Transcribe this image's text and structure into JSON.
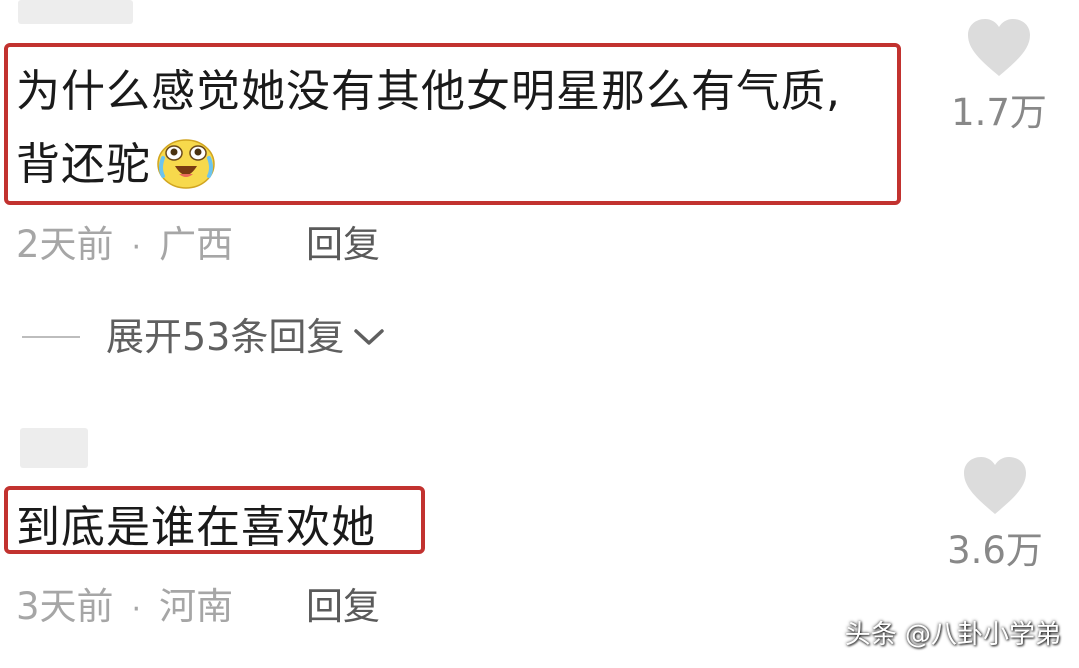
{
  "comments": [
    {
      "text_line1": "为什么感觉她没有其他女明星那么有气质,",
      "text_line2": "背还驼",
      "emoji": "laughing-crying-emoji",
      "time": "2天前",
      "separator": "·",
      "location": "广西",
      "reply_label": "回复",
      "likes": "1.7万",
      "expand_label": "展开53条回复"
    },
    {
      "text_line1": "到底是谁在喜欢她",
      "time": "3天前",
      "separator": "·",
      "location": "河南",
      "reply_label": "回复",
      "likes": "3.6万"
    }
  ],
  "colors": {
    "highlight_border": "#c2322f",
    "meta_text": "#a6a6a6",
    "heart_icon": "#dcdcdc"
  },
  "watermark": "头条 @八卦小学弟"
}
